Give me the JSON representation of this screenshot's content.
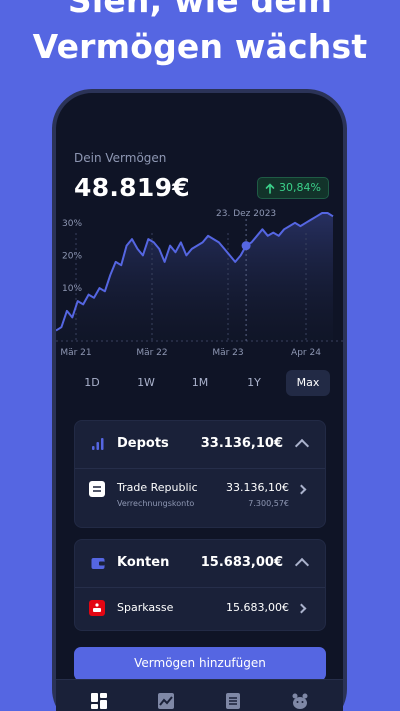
{
  "headline": "Sieh, wie dein Vermögen wächst",
  "summary": {
    "label": "Dein Vermögen",
    "total": "48.819€",
    "change": "30,84%",
    "change_icon": "arrow-up-icon",
    "change_color": "#3bd08a"
  },
  "chart_data": {
    "type": "area",
    "x_tick_labels": [
      "Mär 21",
      "Mär 22",
      "Mär 23",
      "Apr 24"
    ],
    "y_tick_labels": [
      "10%",
      "20%",
      "30%"
    ],
    "ylim": [
      -5,
      33
    ],
    "values": [
      -3,
      -2,
      3,
      1,
      6,
      5,
      8,
      7,
      10,
      9,
      14,
      18,
      17,
      23,
      25,
      22,
      20,
      25,
      24,
      22,
      18,
      23,
      21,
      24,
      20,
      22,
      23,
      24,
      26,
      25,
      24,
      22,
      20,
      18,
      20,
      23,
      24,
      26,
      28,
      26,
      27,
      26,
      28,
      29,
      30,
      29,
      30,
      31,
      32,
      33,
      33,
      32
    ],
    "highlight": {
      "label": "23. Dez 2023",
      "index": 35
    },
    "line_color": "#5566e2",
    "grid": false
  },
  "ranges": [
    "1D",
    "1W",
    "1M",
    "1Y",
    "Max"
  ],
  "active_range": "Max",
  "depots": {
    "title": "Depots",
    "total": "33.136,10€",
    "items": [
      {
        "name": "Trade Republic",
        "value": "33.136,10€",
        "sub": "Verrechnungskonto",
        "subvalue": "7.300,57€"
      }
    ]
  },
  "konten": {
    "title": "Konten",
    "total": "15.683,00€",
    "items": [
      {
        "name": "Sparkasse",
        "value": "15.683,00€"
      }
    ]
  },
  "cta_label": "Vermögen hinzufügen",
  "tabs": [
    "dashboard-icon",
    "chart-icon",
    "list-icon",
    "profile-icon"
  ]
}
